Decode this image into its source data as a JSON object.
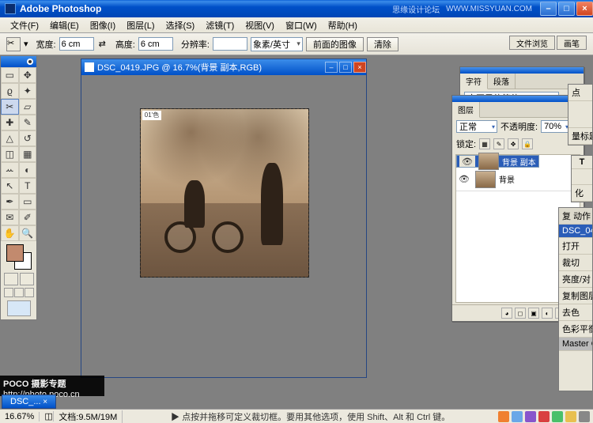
{
  "titlebar": {
    "app": "Adobe Photoshop",
    "watermark1": "思缘设计论坛",
    "watermark2": "WWW.MISSYUAN.COM"
  },
  "menu": {
    "items": [
      "文件(F)",
      "编辑(E)",
      "图像(I)",
      "图层(L)",
      "选择(S)",
      "滤镜(T)",
      "视图(V)",
      "窗口(W)",
      "帮助(H)"
    ]
  },
  "opts": {
    "width_lbl": "宽度:",
    "width_val": "6 cm",
    "height_lbl": "高度:",
    "height_val": "6 cm",
    "res_lbl": "分辨率:",
    "res_val": "",
    "unit": "象素/英寸",
    "btn_front": "前面的图像",
    "btn_clear": "清除"
  },
  "dock": {
    "tab1": "文件浏览",
    "tab2": "画笔"
  },
  "doc": {
    "title": "DSC_0419.JPG @ 16.7%(背景 副本,RGB)",
    "badge": "01'色"
  },
  "char": {
    "tab1": "字符",
    "tab2": "段落",
    "font": "方正黑体简体"
  },
  "layers": {
    "tab": "图层",
    "blend": "正常",
    "opacity_lbl": "不透明度:",
    "opacity_val": "70%",
    "lock_lbl": "锁定:",
    "items": [
      {
        "name": "背景 副本"
      },
      {
        "name": "背景"
      }
    ]
  },
  "rstrips": {
    "a": [
      "点",
      "量标题"
    ],
    "b": [
      "T",
      "化"
    ],
    "c": [
      "复",
      "动作",
      "DSC_04",
      "打开",
      "裁切",
      "亮度/对",
      "复制图层",
      "去色",
      "色彩平衡",
      "Master C"
    ]
  },
  "bottom": {
    "doc_tab": "DSC_...",
    "zoom": "16.67%",
    "docinfo": "文档:9.5M/19M",
    "hint": "▶ 点按并拖移可定义裁切框。要用其他选项，使用 Shift、Alt 和 Ctrl 键。"
  },
  "poco": {
    "brand": "POCO 摄影专题",
    "url": "http://photo.poco.cn"
  }
}
